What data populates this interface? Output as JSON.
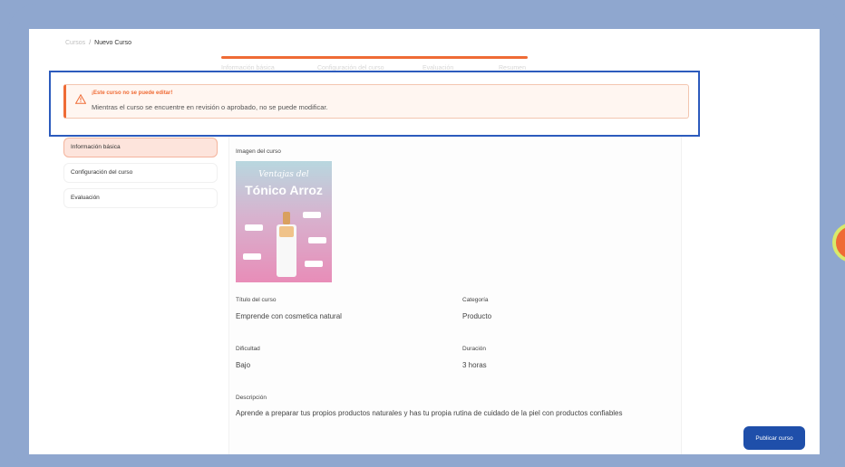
{
  "breadcrumb": {
    "root": "Cursos",
    "separator": "/",
    "current": "Nuevo Curso"
  },
  "steps": [
    {
      "label": "Información básica"
    },
    {
      "label": "Configuración del curso"
    },
    {
      "label": "Evaluación"
    },
    {
      "label": "Resumen"
    }
  ],
  "alert": {
    "title": "¡Este curso no se puede editar!",
    "message": "Mientras el curso se encuentre en revisión o aprobado, no se puede modificar."
  },
  "sidebar": {
    "items": [
      {
        "label": "Información básica",
        "active": true
      },
      {
        "label": "Configuración del curso",
        "active": false
      },
      {
        "label": "Evaluación",
        "active": false
      }
    ]
  },
  "course": {
    "image_label": "Imagen del curso",
    "image_subtitle": "Ventajas del",
    "image_title": "Tónico Arroz",
    "title_label": "Título del curso",
    "title_value": "Emprende con cosmetica natural",
    "category_label": "Categoría",
    "category_value": "Producto",
    "difficulty_label": "Dificultad",
    "difficulty_value": "Bajo",
    "duration_label": "Duración",
    "duration_value": "3 horas",
    "description_label": "Descripción",
    "description_value": "Aprende a preparar tus propios productos naturales y has tu propia rutina de cuidado de la piel con productos confiables"
  },
  "actions": {
    "publish_label": "Publicar curso"
  },
  "colors": {
    "accent": "#ef6b35",
    "primary": "#1f4faa",
    "highlight": "#2c5bbd",
    "background": "#8fa7cf"
  }
}
